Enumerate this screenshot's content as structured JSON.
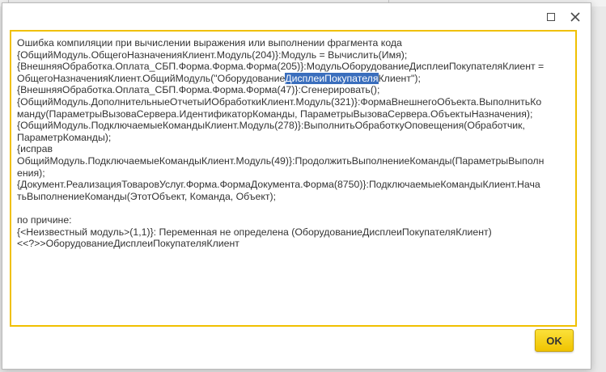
{
  "dialog": {
    "window_buttons": {
      "maximize_icon": "maximize-icon",
      "close_icon": "close-icon"
    },
    "message": {
      "lines": [
        "Ошибка компиляции при вычислении выражения или выполнении фрагмента кода",
        "{ОбщийМодуль.ОбщегоНазначенияКлиент.Модуль(204)}:Модуль = Вычислить(Имя);",
        "{ВнешняяОбработка.Оплата_СБП.Форма.Форма.Форма(205)}:МодульОборудованиеДисплеиПокупателяКлиент =",
        "ОбщегоНазначенияКлиент.ОбщийМодуль(\"Оборудование",
        "{ВнешняяОбработка.Оплата_СБП.Форма.Форма.Форма(47)}:Сгенерировать();",
        "{ОбщийМодуль.ДополнительныеОтчетыИОбработкиКлиент.Модуль(321)}:ФормаВнешнегоОбъекта.ВыполнитьКо",
        "манду(ПараметрыВызоваСервера.ИдентификаторКоманды, ПараметрыВызоваСервера.ОбъектыНазначения);",
        "{ОбщийМодуль.ПодключаемыеКомандыКлиент.Модуль(278)}:ВыполнитьОбработкуОповещения(Обработчик,",
        "ПараметрКоманды);",
        "{исправ",
        "ОбщийМодуль.ПодключаемыеКомандыКлиент.Модуль(49)}:ПродолжитьВыполнениеКоманды(ПараметрыВыполн",
        "ения);",
        "{Документ.РеализацияТоваровУслуг.Форма.ФормаДокумента.Форма(8750)}:ПодключаемыеКомандыКлиент.Нача",
        "тьВыполнениеКоманды(ЭтотОбъект, Команда, Объект);",
        "",
        "по причине:",
        "{<Неизвестный модуль>(1,1)}: Переменная не определена (ОборудованиеДисплеиПокупателяКлиент)",
        "<<?>>ОборудованиеДисплеиПокупателяКлиент"
      ],
      "line4_selected": "ДисплеиПокупателя",
      "line4_after": "Клиент\");"
    },
    "ok_label": "OK"
  }
}
